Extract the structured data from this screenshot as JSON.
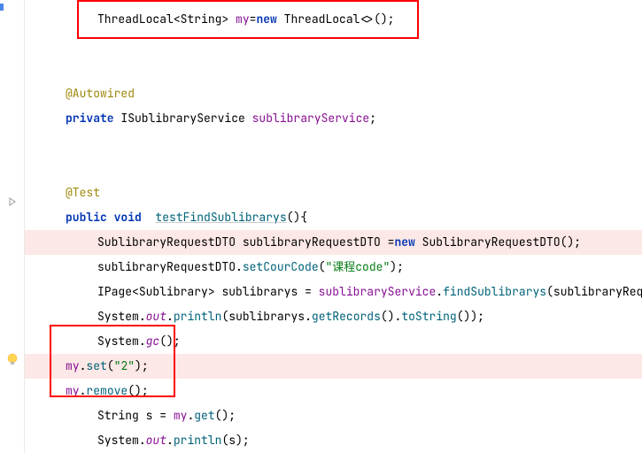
{
  "code": {
    "line1": {
      "type1": "ThreadLocal",
      "generic1": "<String>",
      "var": " my",
      "eq": "=",
      "kw_new": "new ",
      "type2": "ThreadLocal",
      "generic2": "<>",
      "end": "();"
    },
    "line2": {
      "annot": "@Autowired"
    },
    "line3": {
      "kw": "private ",
      "type": "ISublibraryService ",
      "field": "sublibraryService",
      "end": ";"
    },
    "line4": {
      "annot": "@Test"
    },
    "line5": {
      "kw1": "public ",
      "kw2": "void  ",
      "method": "testFindSublibrarys",
      "end": "(){"
    },
    "line6": {
      "type1": "SublibraryRequestDTO ",
      "var": "sublibraryRequestDTO ",
      "eq": "=",
      "kw_new": "new ",
      "type2": "SublibraryRequestDTO",
      "end": "();"
    },
    "line7": {
      "var": "sublibraryRequestDTO",
      "dot": ".",
      "method": "setCourCode",
      "p1": "(",
      "str": "\"课程code\"",
      "p2": ");"
    },
    "line8": {
      "type1": "IPage",
      "lt": "<",
      "type2": "Sublibrary",
      "gt": "> ",
      "var": "sublibrarys",
      "eq": " = ",
      "field": "sublibraryService",
      "dot": ".",
      "method": "findSublibrarys",
      "p1": "(",
      "arg": "sublibraryReque"
    },
    "line9": {
      "cls": "System",
      "dot1": ".",
      "out": "out",
      "dot2": ".",
      "method": "println",
      "p1": "(",
      "var": "sublibrarys",
      "dot3": ".",
      "m2": "getRecords",
      "p2": "().",
      "m3": "toString",
      "p3": "());"
    },
    "line10": {
      "cls": "System",
      "dot": ".",
      "method": "gc",
      "end": "();"
    },
    "line11": {
      "field": "my",
      "dot": ".",
      "method": "set",
      "p1": "(",
      "str": "\"2\"",
      "p2": ");"
    },
    "line12": {
      "field": "my",
      "dot": ".",
      "method": "remove",
      "end": "();"
    },
    "line13": {
      "type": "String ",
      "var": "s",
      "eq": " = ",
      "field": "my",
      "dot": ".",
      "method": "get",
      "end": "();"
    },
    "line14": {
      "cls": "System",
      "dot1": ".",
      "out": "out",
      "dot2": ".",
      "method": "println",
      "p1": "(",
      "var": "s",
      "p2": ");"
    }
  },
  "icons": {
    "bulb": "lightbulb-icon",
    "fold": "fold-icon"
  }
}
